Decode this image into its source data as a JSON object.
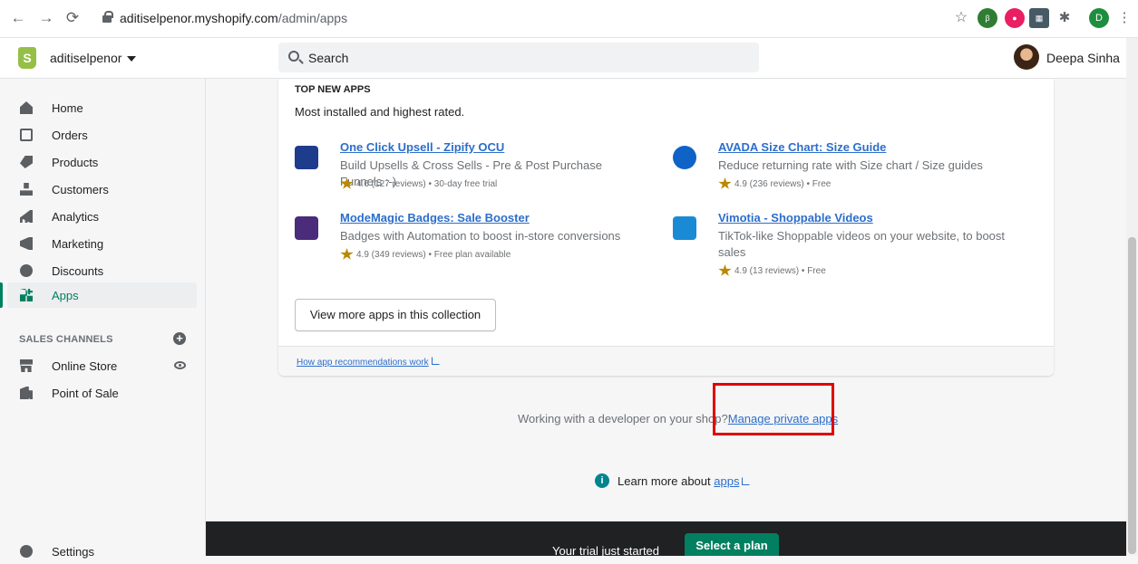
{
  "browser": {
    "url_host": "aditiselpenor.myshopify.com",
    "url_path": "/admin/apps",
    "profile_initial": "D"
  },
  "topbar": {
    "shop_name": "aditiselpenor",
    "search_placeholder": "Search",
    "user_name": "Deepa Sinha"
  },
  "sidebar": {
    "items": [
      {
        "label": "Home",
        "icon": "home-icon"
      },
      {
        "label": "Orders",
        "icon": "orders-icon"
      },
      {
        "label": "Products",
        "icon": "tag-icon"
      },
      {
        "label": "Customers",
        "icon": "person-icon"
      },
      {
        "label": "Analytics",
        "icon": "bar-chart-icon"
      },
      {
        "label": "Marketing",
        "icon": "megaphone-icon"
      },
      {
        "label": "Discounts",
        "icon": "discount-icon"
      },
      {
        "label": "Apps",
        "icon": "apps-icon",
        "active": true
      }
    ],
    "sales_channels_title": "SALES CHANNELS",
    "channels": [
      {
        "label": "Online Store",
        "icon": "store-icon"
      },
      {
        "label": "Point of Sale",
        "icon": "pos-icon"
      }
    ],
    "settings_label": "Settings"
  },
  "card": {
    "heading": "TOP NEW APPS",
    "subheading": "Most installed and highest rated.",
    "apps": [
      {
        "title": "One Click Upsell - Zipify OCU",
        "desc": "Build Upsells & Cross Sells - Pre & Post Purchase Funnels :-)",
        "meta": "4.6 (127 reviews) • 30-day free trial"
      },
      {
        "title": "AVADA Size Chart: Size Guide",
        "desc": "Reduce returning rate with Size chart / Size guides",
        "meta": "4.9 (236 reviews) • Free"
      },
      {
        "title": "ModeMagic Badges: Sale Booster",
        "desc": "Badges with Automation to boost in-store conversions",
        "meta": "4.9 (349 reviews) • Free plan available"
      },
      {
        "title": "Vimotia - Shoppable Videos",
        "desc": "TikTok-like Shoppable videos on your website, to boost sales",
        "meta": "4.9 (13 reviews) • Free"
      }
    ],
    "view_more_label": "View more apps in this collection",
    "footer_link": "How app recommendations work"
  },
  "developer": {
    "text": "Working with a developer on your shop?",
    "link": "Manage private apps"
  },
  "learn": {
    "text": "Learn more about",
    "link": "apps"
  },
  "banner": {
    "text": "Your trial just started",
    "button": "Select a plan"
  },
  "colors": {
    "accent": "#008060",
    "link": "#2c6ecb",
    "highlight": "#e00000"
  }
}
